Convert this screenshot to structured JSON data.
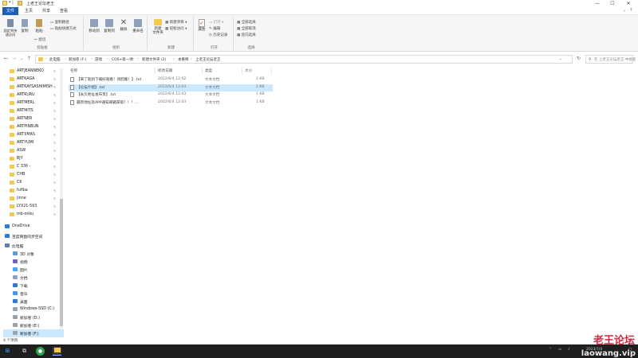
{
  "window": {
    "title": "上老王论坛老王",
    "controls": {
      "minimize": "—",
      "maximize": "☐",
      "close": "✕"
    }
  },
  "tabs": [
    "文件",
    "主页",
    "共享",
    "查看"
  ],
  "ribbon": {
    "clipboard": {
      "label": "剪贴板",
      "pin": "固定到快速访问",
      "copy": "复制",
      "paste": "粘贴",
      "cut": "剪切",
      "copy_path": "复制路径",
      "paste_shortcut": "粘贴快捷方式"
    },
    "organize": {
      "label": "组织",
      "move_to": "移动到",
      "copy_to": "复制到",
      "delete": "删除",
      "rename": "重命名"
    },
    "new": {
      "label": "新建",
      "new_folder": "新建\n文件夹",
      "new_item": "新建项目 ▾",
      "easy_access": "轻松访问 ▾"
    },
    "open": {
      "label": "打开",
      "properties": "属性",
      "open": "打开 ▾",
      "edit": "编辑",
      "history": "历史记录"
    },
    "select": {
      "label": "选择",
      "select_all": "全部选择",
      "select_none": "全部取消",
      "invert": "反向选择"
    }
  },
  "address": {
    "back": "←",
    "forward": "→",
    "recent": "⌄",
    "up": "↑",
    "crumbs": [
      "此电脑",
      "新加卷 (F:)",
      "游戏",
      "COS+第一弹",
      "新建文件夹 (2)",
      "本重稀",
      "上老王论坛老王"
    ],
    "refresh": "↻",
    "search_placeholder": "在 上老王论坛老王 中搜索"
  },
  "nav": {
    "pinned_folders": [
      "ARTJEANNEKO",
      "ARTKAGA",
      "ARTKAYSASHIMISH",
      "ARTKURU",
      "ARTMERL",
      "ARTMITS",
      "ARTNER",
      "ARTPINBUN",
      "ARTXMAS",
      "ARTYUMI",
      "ASW",
      "BJY",
      "C 336 -",
      "CHB",
      "CK",
      "fufiba",
      "jinne",
      "LYX21-593",
      "mb-miku"
    ],
    "onedrive": "OneDrive",
    "network_sync": "百度网盘同步空间",
    "this_pc": "此电脑",
    "pc_items": [
      "3D 对象",
      "视频",
      "图片",
      "文档",
      "下载",
      "音乐",
      "桌面",
      "Windows-SSD (C:)",
      "新加卷 (D:)",
      "新加卷 (E:)",
      "新加卷 (F:)"
    ]
  },
  "list": {
    "columns": [
      "名称",
      "修改日期",
      "类型",
      "大小"
    ],
    "rows": [
      {
        "name": "【来了就别下载好观看！诗韵集！】.txt",
        "date": "2022/6/4 12:02",
        "type": "文本文档",
        "size": "2 KB"
      },
      {
        "name": "【论坛介绍】.txt",
        "date": "2022/6/4 12:03",
        "type": "文本文档",
        "size": "2 KB"
      },
      {
        "name": "【永久地址发布页】.txt",
        "date": "2022/6/4 12:03",
        "type": "文本文档",
        "size": "1 KB"
      },
      {
        "name": "最新地址及APP通知邮箱获取！！！...",
        "date": "2022/6/4 12:03",
        "type": "文本文档",
        "size": "1 KB"
      }
    ]
  },
  "status": {
    "count": "4 个项目"
  },
  "taskbar": {
    "start": "⊞",
    "search": "⚲",
    "clock_time": "",
    "clock_date": "2023/7/4"
  },
  "watermark": {
    "line1": "老王论坛",
    "line2": "laowang.vip"
  },
  "colors": {
    "accent": "#1a5fb4",
    "folder": "#f4c74f",
    "selection": "#cce8ff",
    "taskbar": "#1f1f1f"
  }
}
